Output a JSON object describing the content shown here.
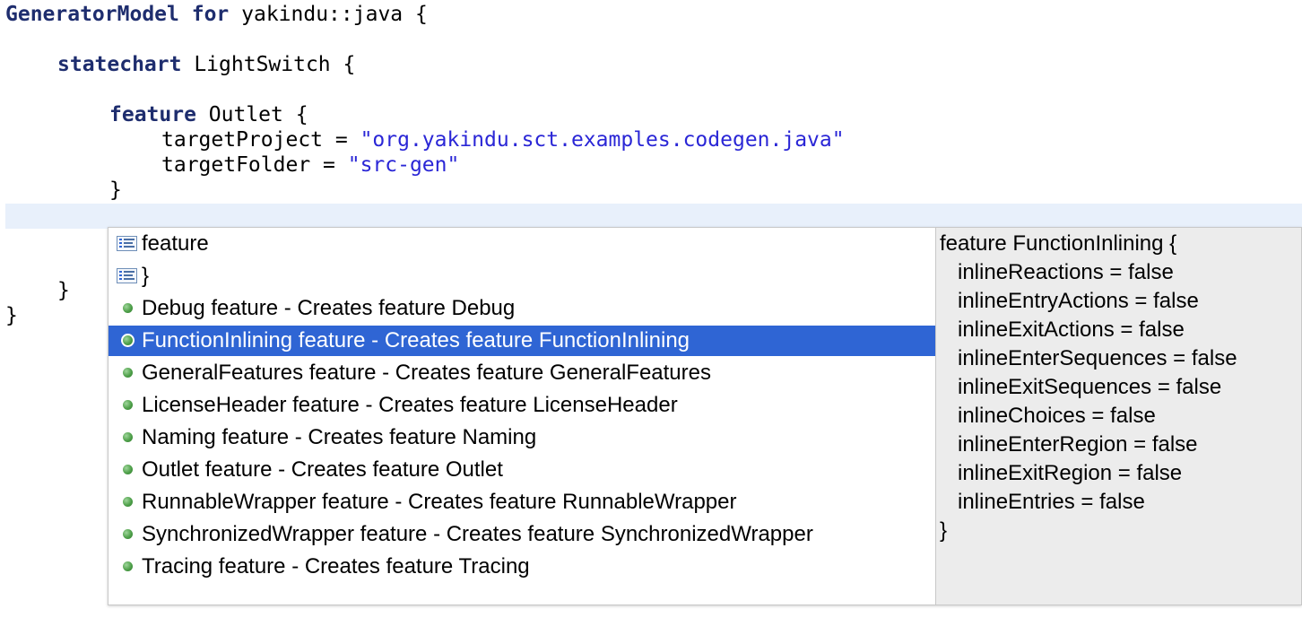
{
  "editor": {
    "lines": {
      "l1": {
        "kw1": "GeneratorModel",
        "kw2": "for",
        "rest": " yakindu::java {"
      },
      "l2": {
        "kw": "statechart",
        "rest": " LightSwitch {"
      },
      "l3": {
        "kw": "feature",
        "rest": " Outlet {"
      },
      "l4": {
        "pre": "targetProject = ",
        "str": "\"org.yakindu.sct.examples.codegen.java\""
      },
      "l5": {
        "pre": "targetFolder = ",
        "str": "\"src-gen\""
      },
      "l6": "}",
      "l7": "}",
      "l8": "}"
    }
  },
  "colors": {
    "keyword": "#1e2d6e",
    "string": "#2a26d6",
    "selection": "#2f65d4",
    "current_line": "#e8f0fb",
    "doc_background": "#ececec",
    "proposal_dot": "#4fa04a"
  },
  "content_assist": {
    "selected_index": 3,
    "proposals": [
      {
        "label": "feature",
        "icon": "keyword-icon"
      },
      {
        "label": "}",
        "icon": "keyword-icon"
      },
      {
        "label": "Debug feature - Creates feature Debug",
        "icon": "template-icon"
      },
      {
        "label": "FunctionInlining feature - Creates feature FunctionInlining",
        "icon": "template-icon"
      },
      {
        "label": "GeneralFeatures feature - Creates feature GeneralFeatures",
        "icon": "template-icon"
      },
      {
        "label": "LicenseHeader feature - Creates feature LicenseHeader",
        "icon": "template-icon"
      },
      {
        "label": "Naming feature - Creates feature Naming",
        "icon": "template-icon"
      },
      {
        "label": "Outlet feature - Creates feature Outlet",
        "icon": "template-icon"
      },
      {
        "label": "RunnableWrapper feature - Creates feature RunnableWrapper",
        "icon": "template-icon"
      },
      {
        "label": "SynchronizedWrapper feature - Creates feature SynchronizedWrapper",
        "icon": "template-icon"
      },
      {
        "label": "Tracing feature - Creates feature Tracing",
        "icon": "template-icon"
      }
    ],
    "preview": [
      "feature FunctionInlining {",
      "   inlineReactions = false",
      "   inlineEntryActions = false",
      "   inlineExitActions = false",
      "   inlineEnterSequences = false",
      "   inlineExitSequences = false",
      "   inlineChoices = false",
      "   inlineEnterRegion = false",
      "   inlineExitRegion = false",
      "   inlineEntries = false",
      "}"
    ]
  }
}
